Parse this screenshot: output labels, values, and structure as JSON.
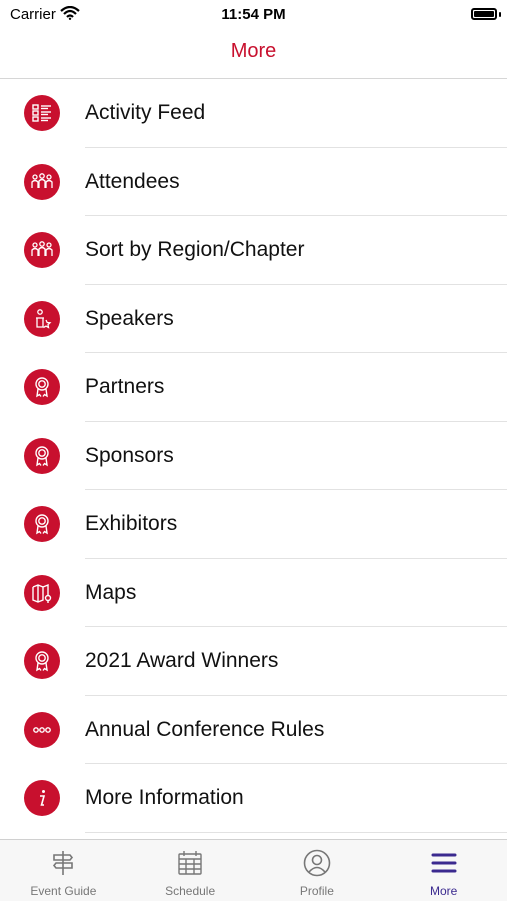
{
  "status_bar": {
    "carrier": "Carrier",
    "time": "11:54 PM"
  },
  "nav": {
    "title": "More"
  },
  "colors": {
    "accent": "#c8102e",
    "active_tab": "#3b2a8f",
    "inactive_tab": "#777777"
  },
  "menu": {
    "items": [
      {
        "label": "Activity Feed",
        "icon": "list-icon"
      },
      {
        "label": "Attendees",
        "icon": "people-icon"
      },
      {
        "label": "Sort by Region/Chapter",
        "icon": "people-icon"
      },
      {
        "label": "Speakers",
        "icon": "speaker-podium-icon"
      },
      {
        "label": "Partners",
        "icon": "award-ribbon-icon"
      },
      {
        "label": "Sponsors",
        "icon": "award-ribbon-icon"
      },
      {
        "label": "Exhibitors",
        "icon": "award-ribbon-icon"
      },
      {
        "label": "Maps",
        "icon": "map-icon"
      },
      {
        "label": "2021 Award Winners",
        "icon": "award-ribbon-icon"
      },
      {
        "label": "Annual Conference Rules",
        "icon": "ellipsis-icon"
      },
      {
        "label": "More Information",
        "icon": "info-icon"
      }
    ]
  },
  "tabs": [
    {
      "label": "Event Guide",
      "icon": "signpost-icon",
      "active": false
    },
    {
      "label": "Schedule",
      "icon": "calendar-icon",
      "active": false
    },
    {
      "label": "Profile",
      "icon": "profile-icon",
      "active": false
    },
    {
      "label": "More",
      "icon": "menu-icon",
      "active": true
    }
  ]
}
